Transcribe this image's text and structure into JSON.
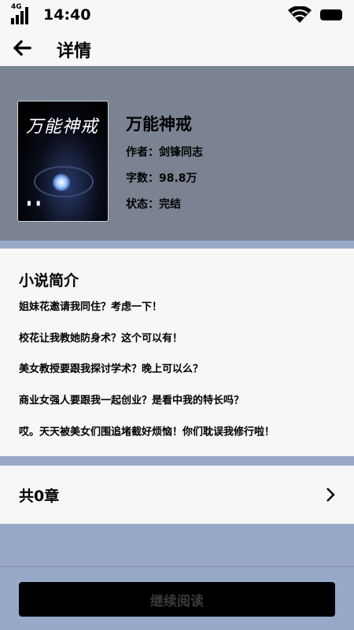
{
  "status_bar": {
    "network": "4G",
    "time": "14:40"
  },
  "nav": {
    "title": "详情"
  },
  "book": {
    "title": "万能神戒",
    "cover_text": "万能神戒",
    "author": "作者：剑锋同志",
    "word_count": "字数：98.8万",
    "status": "状态：完结"
  },
  "intro": {
    "heading": "小说简介",
    "lines": [
      "姐妹花邀请我同住？考虑一下！",
      "校花让我教她防身术？这个可以有！",
      "美女教授要跟我探讨学术？晚上可以么？",
      "商业女强人要跟我一起创业？是看中我的特长吗？",
      "哎。天天被美女们围追堵截好烦恼！你们耽误我修行啦！"
    ]
  },
  "chapters": {
    "count_label": "共0章"
  },
  "actions": {
    "continue_label": "继续阅读"
  },
  "icons": {
    "back": "arrow-left-icon",
    "chevron": "chevron-right-icon",
    "wifi": "wifi-icon",
    "battery": "battery-icon",
    "signal": "signal-icon"
  },
  "colors": {
    "page_bg": "#98a8c8",
    "header_bg": "#7b8392",
    "panel_bg": "#f7f7f7",
    "button_bg": "#000000"
  }
}
